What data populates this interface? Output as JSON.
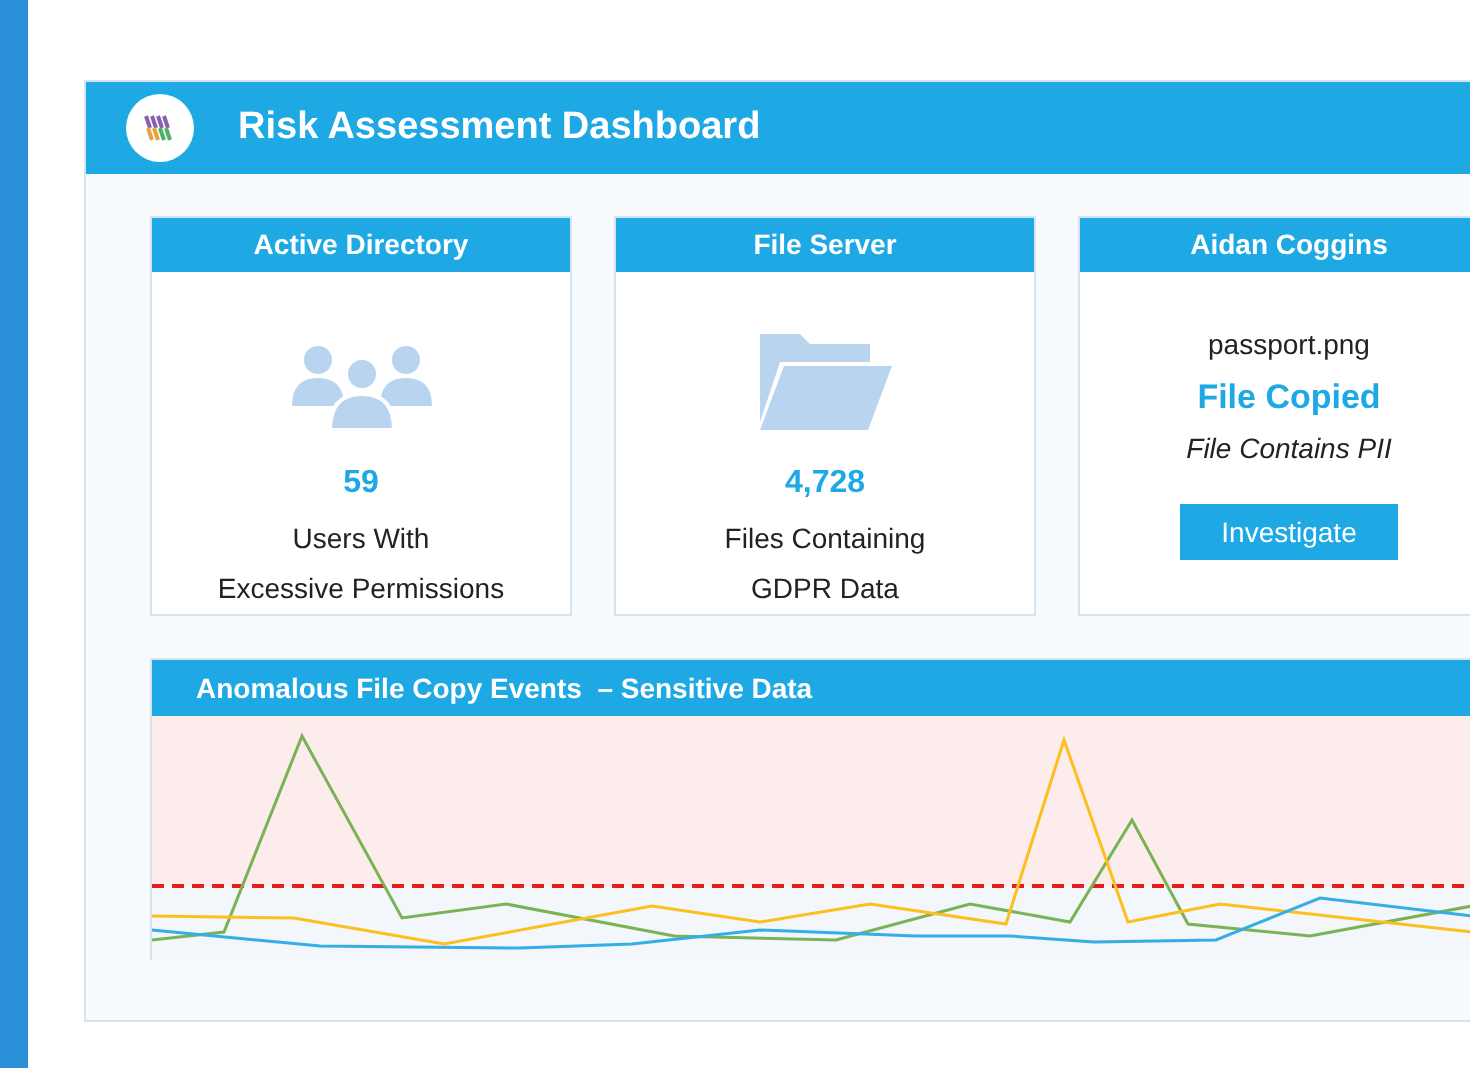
{
  "header": {
    "title": "Risk Assessment Dashboard"
  },
  "cards": [
    {
      "kind": "users",
      "title": "Active Directory",
      "value": "59",
      "lines": [
        "Users With",
        "Excessive Permissions"
      ]
    },
    {
      "kind": "files",
      "title": "File Server",
      "value": "4,728",
      "lines": [
        "Files Containing",
        "GDPR Data"
      ]
    },
    {
      "kind": "event",
      "title": "Aidan Coggins",
      "file": "passport.png",
      "event": "File Copied",
      "note": "File Contains PII",
      "button": "Investigate"
    }
  ],
  "chart_panel": {
    "title": "Anomalous File Copy Events  – Sensitive Data"
  }
}
